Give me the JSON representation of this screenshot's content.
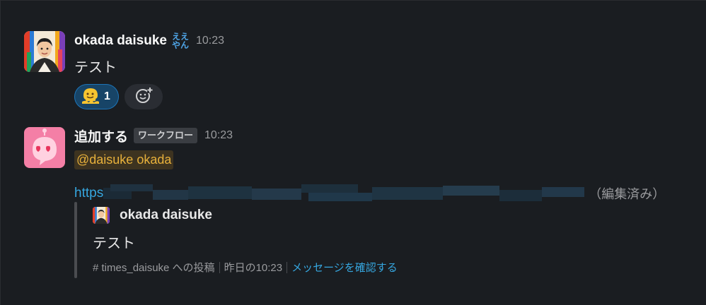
{
  "messages": [
    {
      "sender": "okada daisuke",
      "status_emoji_lines": [
        "ええ",
        "やん"
      ],
      "timestamp": "10:23",
      "text": "テスト",
      "reactions": [
        {
          "emoji": "melting-face",
          "count": "1"
        }
      ]
    },
    {
      "sender": "追加する",
      "tag": "ワークフロー",
      "timestamp": "10:23",
      "mention": "@daisuke okada",
      "link_prefix": "https",
      "edited_label": "（編集済み）",
      "quote": {
        "author": "okada daisuke",
        "text": "テスト",
        "channel": "# times_daisuke への投稿",
        "time": "昨日の10:23",
        "view_link": "メッセージを確認する"
      }
    }
  ],
  "icons": {
    "reaction_emoji": "melting-face-icon",
    "add_reaction": "add-reaction-icon",
    "bot_avatar": "heart-eyes-robot-icon"
  },
  "colors": {
    "background": "#1a1d21",
    "link": "#36a7e0",
    "mention_text": "#e8b13b",
    "mention_bg": "#3d3320",
    "reaction_bg": "#174467"
  }
}
